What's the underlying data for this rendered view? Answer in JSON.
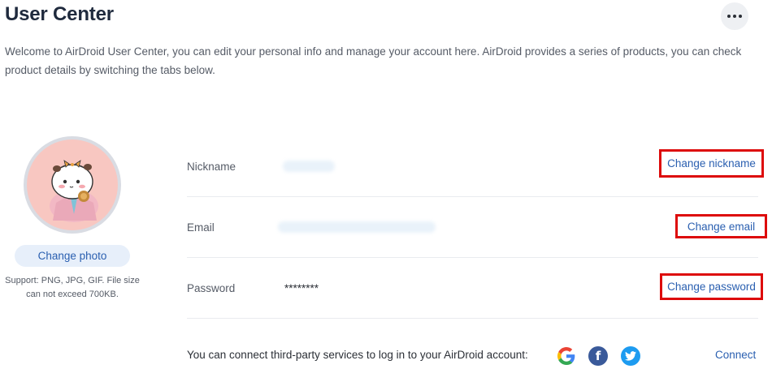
{
  "header": {
    "title": "User Center",
    "more_icon": "more-horizontal-icon"
  },
  "intro": {
    "text": "Welcome to AirDroid User Center, you can edit your personal info and manage your account here. AirDroid provides a series of products, you can check product details by switching the tabs below."
  },
  "profile": {
    "avatar_icon": "cartoon-avatar",
    "change_photo_label": "Change photo",
    "photo_hint": "Support: PNG, JPG, GIF. File size can not exceed 700KB."
  },
  "account": {
    "rows": [
      {
        "label": "Nickname",
        "value": "",
        "action": "Change nickname"
      },
      {
        "label": "Email",
        "value": "",
        "action": "Change email"
      },
      {
        "label": "Password",
        "value": "********",
        "action": "Change password"
      }
    ]
  },
  "third_party": {
    "text": "You can connect third-party services to log in to your AirDroid account:",
    "services": [
      "google-icon",
      "facebook-icon",
      "twitter-icon"
    ],
    "connect_label": "Connect"
  },
  "colors": {
    "link": "#2a5fb0",
    "highlight_border": "#dd0a0a",
    "title": "#1f2a3d"
  }
}
